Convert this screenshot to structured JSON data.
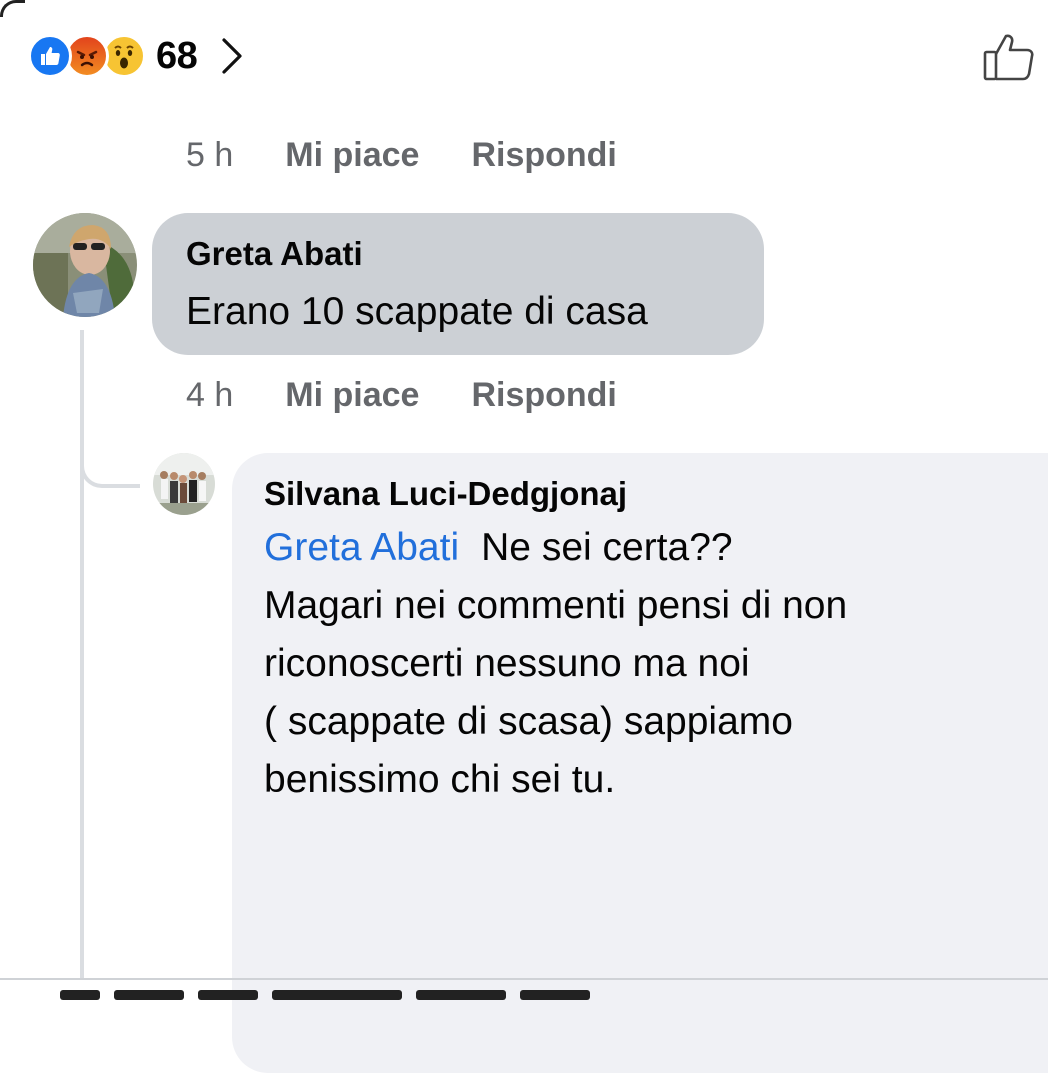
{
  "reactions": {
    "icons": [
      "like-reaction-icon",
      "angry-reaction-icon",
      "wow-reaction-icon"
    ],
    "count": "68"
  },
  "comments": [
    {
      "meta": {
        "time": "5 h",
        "like_label": "Mi piace",
        "reply_label": "Rispondi"
      }
    },
    {
      "author": "Greta Abati",
      "text": "Erano 10 scappate di casa",
      "meta": {
        "time": "4 h",
        "like_label": "Mi piace",
        "reply_label": "Rispondi"
      }
    },
    {
      "author": "Silvana Luci-Dedgjonaj",
      "mention": "Greta Abati",
      "text_first": "Ne sei certa??",
      "lines": [
        "Magari nei commenti pensi di non",
        "riconoscerti nessuno ma noi",
        "( scappate di scasa) sappiamo",
        "benissimo chi sei tu."
      ]
    }
  ],
  "colors": {
    "like_blue": "#1877f2",
    "mention_blue": "#216fdb",
    "bubble_gray": "#ccd0d5",
    "bubble_light": "#f0f1f5",
    "meta_gray": "#65676b"
  }
}
